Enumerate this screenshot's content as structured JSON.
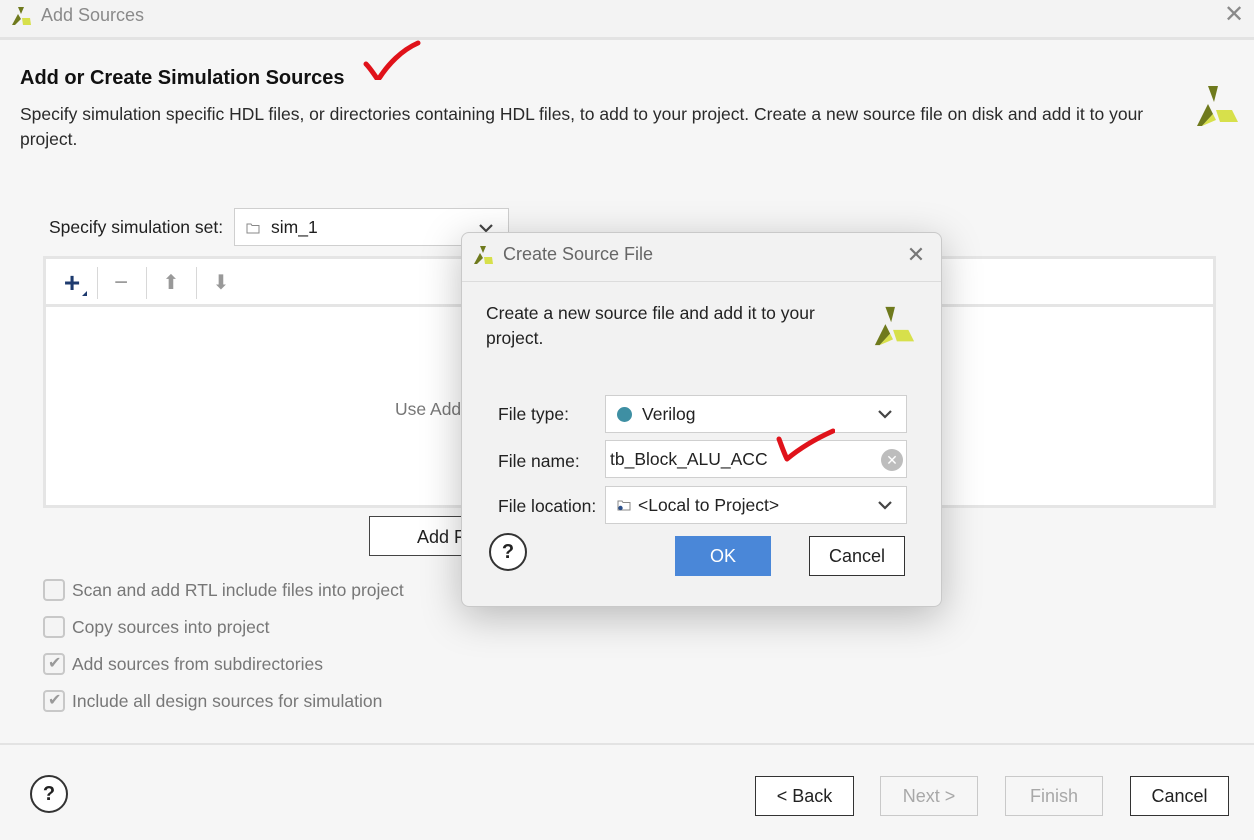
{
  "window": {
    "title": "Add Sources",
    "close_glyph": "✕"
  },
  "page": {
    "heading": "Add or Create Simulation Sources",
    "description": "Specify simulation specific HDL files, or directories containing HDL files, to add to your project. Create a new source file on disk and add it to your project."
  },
  "simulation_set": {
    "label": "Specify simulation set:",
    "value": "sim_1"
  },
  "files_panel": {
    "toolbar": {
      "add_glyph": "+",
      "remove_glyph": "−",
      "up_glyph": "⬆",
      "down_glyph": "⬇"
    },
    "hint_visible": "Use Add"
  },
  "add_files_button_visible": "Add F",
  "options": [
    {
      "label": "Scan and add RTL include files into project",
      "checked": false
    },
    {
      "label": "Copy sources into project",
      "checked": false
    },
    {
      "label": "Add sources from subdirectories",
      "checked": true
    },
    {
      "label": "Include all design sources for simulation",
      "checked": true
    }
  ],
  "footer": {
    "help_glyph": "?",
    "back_label": "< Back",
    "next_label": "Next >",
    "finish_label": "Finish",
    "cancel_label": "Cancel"
  },
  "dialog": {
    "title": "Create Source File",
    "close_glyph": "✕",
    "description": "Create a new source file and add it to your project.",
    "file_type": {
      "label": "File type:",
      "value": "Verilog"
    },
    "file_name": {
      "label": "File name:",
      "value": "tb_Block_ALU_ACC",
      "clear_glyph": "✕"
    },
    "file_location": {
      "label": "File location:",
      "value": "<Local to Project>"
    },
    "help_glyph": "?",
    "ok_label": "OK",
    "cancel_label": "Cancel"
  },
  "colors": {
    "accent": "#4a87d8",
    "logo_dark": "#6f7a1d",
    "logo_light": "#d7e04b",
    "annotation": "#e0121a",
    "verilog_dot": "#3e8fa3"
  },
  "icons": {
    "app_logo": "xilinx-logo-icon",
    "folder": "folder-icon",
    "chevron": "chevron-down-icon",
    "help": "help-icon",
    "annotation": "red-checkmark-icon"
  }
}
